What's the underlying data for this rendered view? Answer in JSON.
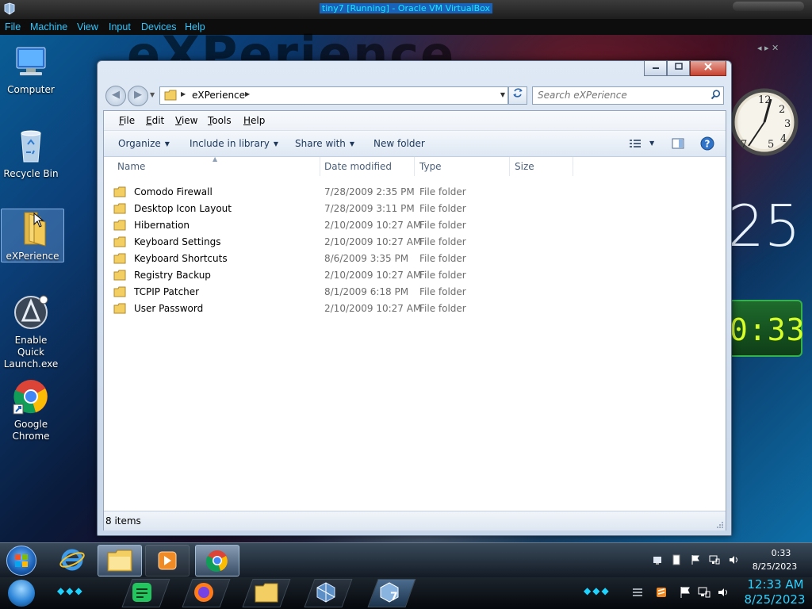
{
  "host": {
    "title": "tiny7 [Running] - Oracle VM VirtualBox",
    "menu": [
      "File",
      "Machine",
      "View",
      "Input",
      "Devices",
      "Help"
    ],
    "time": "12:33 AM",
    "date": "8/25/2023"
  },
  "desktop": {
    "wallpaper_text": "eXPerience",
    "icons": [
      {
        "label": "Computer",
        "icon": "computer-icon"
      },
      {
        "label": "Recycle Bin",
        "icon": "recycle-bin-icon"
      },
      {
        "label": "eXPerience",
        "icon": "folder-icon",
        "selected": true
      },
      {
        "label": "Enable Quick Launch.exe",
        "icon": "app-icon"
      },
      {
        "label": "Google Chrome",
        "icon": "chrome-icon"
      }
    ],
    "gadgets": {
      "big_time": "25",
      "digital_time": "0:33"
    }
  },
  "explorer": {
    "address": {
      "segments": [
        "eXPerience"
      ]
    },
    "search": {
      "placeholder": "Search eXPerience"
    },
    "menu": [
      {
        "label": "File",
        "accel": "F",
        "rest": "ile"
      },
      {
        "label": "Edit",
        "accel": "E",
        "rest": "dit"
      },
      {
        "label": "View",
        "accel": "V",
        "rest": "iew"
      },
      {
        "label": "Tools",
        "accel": "T",
        "rest": "ools"
      },
      {
        "label": "Help",
        "accel": "H",
        "rest": "elp"
      }
    ],
    "commands": {
      "organize": "Organize",
      "include": "Include in library",
      "share": "Share with",
      "new_folder": "New folder"
    },
    "columns": [
      "Name",
      "Date modified",
      "Type",
      "Size"
    ],
    "files": [
      {
        "name": "Comodo Firewall",
        "date": "7/28/2009 2:35 PM",
        "type": "File folder"
      },
      {
        "name": "Desktop Icon Layout",
        "date": "7/28/2009 3:11 PM",
        "type": "File folder"
      },
      {
        "name": "Hibernation",
        "date": "2/10/2009 10:27 AM",
        "type": "File folder"
      },
      {
        "name": "Keyboard Settings",
        "date": "2/10/2009 10:27 AM",
        "type": "File folder"
      },
      {
        "name": "Keyboard Shortcuts",
        "date": "8/6/2009 3:35 PM",
        "type": "File folder"
      },
      {
        "name": "Registry Backup",
        "date": "2/10/2009 10:27 AM",
        "type": "File folder"
      },
      {
        "name": "TCPIP Patcher",
        "date": "8/1/2009 6:18 PM",
        "type": "File folder"
      },
      {
        "name": "User Password",
        "date": "2/10/2009 10:27 AM",
        "type": "File folder"
      }
    ],
    "status": "8 items"
  },
  "taskbar": {
    "time": "0:33",
    "date": "8/25/2023"
  },
  "colors": {
    "host_accent": "#2fc7ff",
    "digital_green": "#d7ff2a"
  }
}
